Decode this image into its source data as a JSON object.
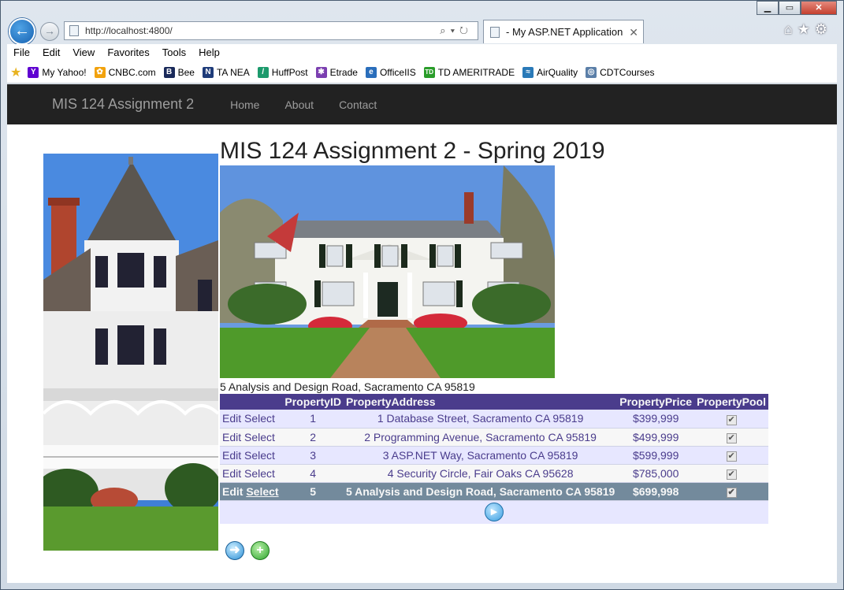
{
  "browser": {
    "address": "http://localhost:4800/",
    "tab_title": "- My ASP.NET Application",
    "tab_close": "✕",
    "menu": [
      "File",
      "Edit",
      "View",
      "Favorites",
      "Tools",
      "Help"
    ],
    "favorites": [
      {
        "label": "My Yahoo!",
        "icon": "Y",
        "color": "#5f01d1"
      },
      {
        "label": "CNBC.com",
        "icon": "✿",
        "color": "#f2a20d"
      },
      {
        "label": "Bee",
        "icon": "B",
        "color": "#1a2a5a"
      },
      {
        "label": "TA NEA",
        "icon": "N",
        "color": "#1f3c7a"
      },
      {
        "label": "HuffPost",
        "icon": "/",
        "color": "#1c9a6c"
      },
      {
        "label": "Etrade",
        "icon": "✱",
        "color": "#7b3fb0"
      },
      {
        "label": "OfficeIIS",
        "icon": "e",
        "color": "#2a6ebb"
      },
      {
        "label": "TD AMERITRADE",
        "icon": "TD",
        "color": "#2a9d2a"
      },
      {
        "label": "AirQuality",
        "icon": "≈",
        "color": "#2a7ab8"
      },
      {
        "label": "CDTCourses",
        "icon": "◎",
        "color": "#5b7fa8"
      }
    ]
  },
  "site": {
    "brand": "MIS 124 Assignment 2",
    "nav": [
      "Home",
      "About",
      "Contact"
    ],
    "title": "MIS 124 Assignment 2 - Spring 2019",
    "selected_label": "5 Analysis and Design Road, Sacramento CA 95819"
  },
  "grid": {
    "headers": {
      "id": "PropertyID",
      "address": "PropertyAddress",
      "price": "PropertyPrice",
      "pool": "PropertyPool"
    },
    "edit_label": "Edit",
    "select_label": "Select",
    "rows": [
      {
        "id": "1",
        "address": "1 Database Street, Sacramento CA 95819",
        "price": "$399,999",
        "pool": true
      },
      {
        "id": "2",
        "address": "2 Programming Avenue, Sacramento CA 95819",
        "price": "$499,999",
        "pool": true
      },
      {
        "id": "3",
        "address": "3 ASP.NET Way, Sacramento CA 95819",
        "price": "$599,999",
        "pool": true
      },
      {
        "id": "4",
        "address": "4 Security Circle, Fair Oaks CA 95628",
        "price": "$785,000",
        "pool": true
      },
      {
        "id": "5",
        "address": "5 Analysis and Design Road, Sacramento CA 95819",
        "price": "$699,998",
        "pool": true
      }
    ],
    "selected_index": 4
  },
  "colors": {
    "grid_header": "#4a3c8c",
    "grid_selected": "#738a9c",
    "navbar": "#222222"
  },
  "icons": {
    "back": "back-arrow-icon",
    "forward": "forward-arrow-icon",
    "pager": "play-icon",
    "next": "next-arrow-icon",
    "add": "plus-icon"
  }
}
